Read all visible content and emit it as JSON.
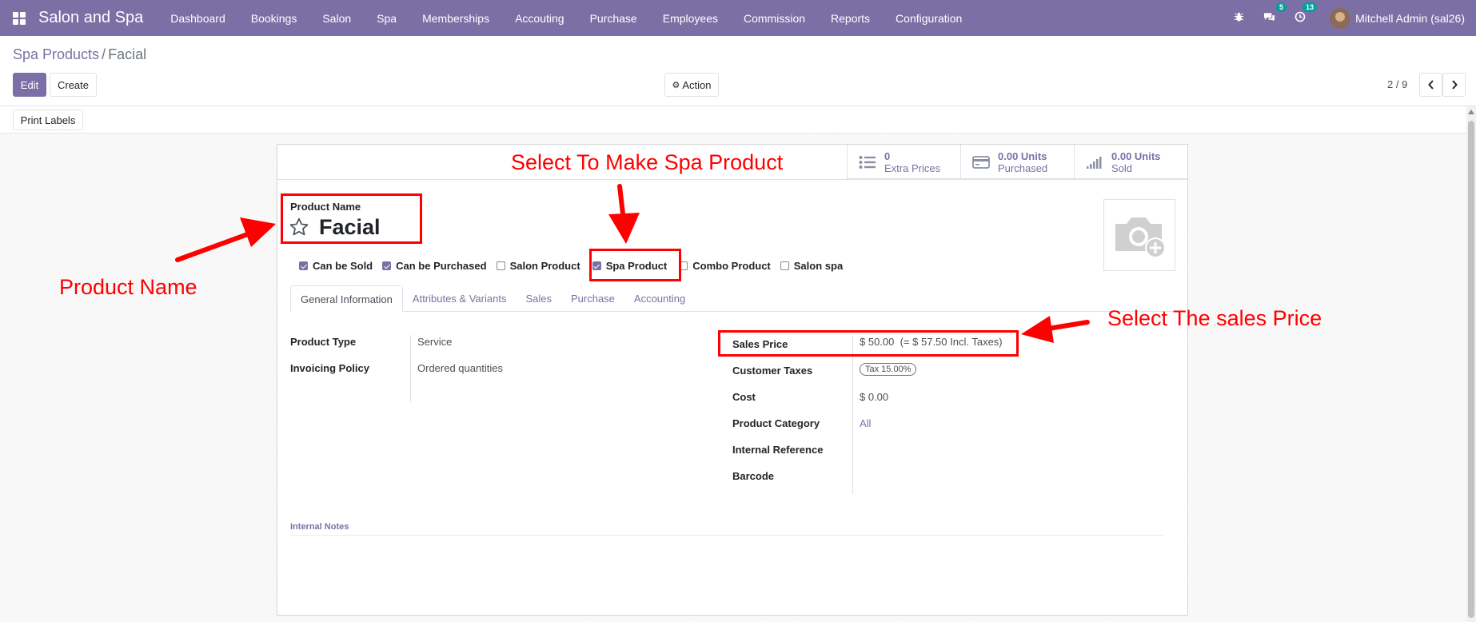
{
  "app": {
    "brand": "Salon and Spa",
    "menu": [
      "Dashboard",
      "Bookings",
      "Salon",
      "Spa",
      "Memberships",
      "Accouting",
      "Purchase",
      "Employees",
      "Commission",
      "Reports",
      "Configuration"
    ],
    "messages_count": "5",
    "activities_count": "13",
    "user": "Mitchell Admin (sal26)"
  },
  "breadcrumb": {
    "parent": "Spa Products",
    "separator": "/",
    "current": "Facial"
  },
  "toolbar": {
    "edit": "Edit",
    "create": "Create",
    "action": "Action",
    "pager": "2 / 9",
    "print_labels": "Print Labels"
  },
  "smart_buttons": [
    {
      "value": "0",
      "label": "Extra Prices",
      "icon": "list-icon"
    },
    {
      "value": "0.00 Units",
      "label": "Purchased",
      "icon": "credit-card-icon"
    },
    {
      "value": "0.00 Units",
      "label": "Sold",
      "icon": "signal-icon"
    }
  ],
  "product": {
    "name_label": "Product Name",
    "name": "Facial"
  },
  "checkboxes": [
    {
      "label": "Can be Sold",
      "checked": true
    },
    {
      "label": "Can be Purchased",
      "checked": true
    },
    {
      "label": "Salon Product",
      "checked": false
    },
    {
      "label": "Spa Product",
      "checked": true
    },
    {
      "label": "Combo Product",
      "checked": false
    },
    {
      "label": "Salon spa",
      "checked": false
    }
  ],
  "tabs": [
    "General Information",
    "Attributes & Variants",
    "Sales",
    "Purchase",
    "Accounting"
  ],
  "general": {
    "product_type_label": "Product Type",
    "product_type": "Service",
    "invoicing_policy_label": "Invoicing Policy",
    "invoicing_policy": "Ordered quantities",
    "sales_price_label": "Sales Price",
    "sales_price": "$ 50.00",
    "sales_price_incl": "(= $ 57.50 Incl. Taxes)",
    "customer_taxes_label": "Customer Taxes",
    "customer_taxes": "Tax 15.00%",
    "cost_label": "Cost",
    "cost": "$ 0.00",
    "category_label": "Product Category",
    "category": "All",
    "internal_ref_label": "Internal Reference",
    "barcode_label": "Barcode",
    "internal_notes_label": "Internal Notes"
  },
  "annotations": {
    "spa_product": "Select To Make Spa Product",
    "product_name": "Product Name",
    "sales_price": "Select The sales Price",
    "color": "#ff0000"
  },
  "colors": {
    "primary": "#7c6fa6",
    "badge": "#00a09d",
    "annotation": "#ff0000"
  }
}
